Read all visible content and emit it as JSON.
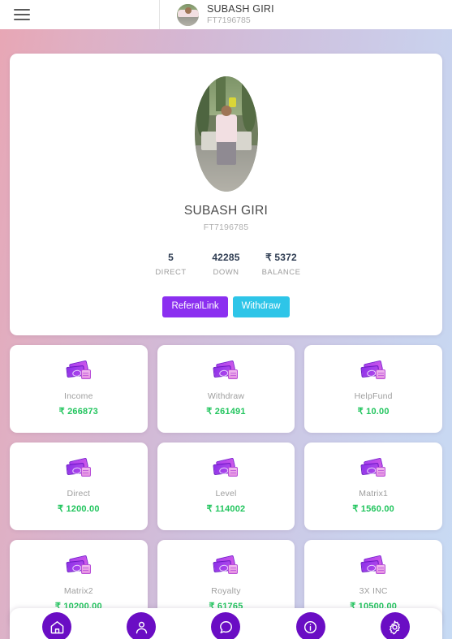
{
  "header": {
    "menu_icon": "hamburger-menu-icon",
    "user_name": "SUBASH GIRI",
    "user_id": "FT7196785"
  },
  "profile": {
    "avatar_icon": "user-photo-avatar",
    "name": "SUBASH GIRI",
    "id": "FT7196785",
    "stats": [
      {
        "value": "5",
        "label": "DIRECT"
      },
      {
        "value": "42285",
        "label": "DOWN"
      },
      {
        "value": "₹ 5372",
        "label": "BALANCE"
      }
    ],
    "actions": {
      "referral_label": "ReferalLink",
      "withdraw_label": "Withdraw"
    }
  },
  "cards": [
    {
      "icon": "money-stack-icon",
      "title": "Income",
      "value": "₹ 266873"
    },
    {
      "icon": "money-stack-icon",
      "title": "Withdraw",
      "value": "₹ 261491"
    },
    {
      "icon": "money-stack-icon",
      "title": "HelpFund",
      "value": "₹ 10.00"
    },
    {
      "icon": "money-stack-icon",
      "title": "Direct",
      "value": "₹ 1200.00"
    },
    {
      "icon": "money-stack-icon",
      "title": "Level",
      "value": "₹ 114002"
    },
    {
      "icon": "money-stack-icon",
      "title": "Matrix1",
      "value": "₹ 1560.00"
    },
    {
      "icon": "money-stack-icon",
      "title": "Matrix2",
      "value": "₹ 10200.00"
    },
    {
      "icon": "money-stack-icon",
      "title": "Royalty",
      "value": "₹ 61765"
    },
    {
      "icon": "money-stack-icon",
      "title": "3X INC",
      "value": "₹ 10500.00"
    }
  ],
  "bottom_nav": [
    {
      "icon": "home-icon",
      "name": "nav-home"
    },
    {
      "icon": "person-icon",
      "name": "nav-profile"
    },
    {
      "icon": "chat-icon",
      "name": "nav-support"
    },
    {
      "icon": "info-icon",
      "name": "nav-info"
    },
    {
      "icon": "gear-icon",
      "name": "nav-settings"
    }
  ],
  "colors": {
    "accent_purple": "#8b2ff0",
    "accent_cyan": "#2ec5e8",
    "value_green": "#22c55e",
    "nav_purple": "#6a0dc4",
    "bg_pink": "#e8a6b4",
    "bg_blue": "#c7dbf4"
  }
}
